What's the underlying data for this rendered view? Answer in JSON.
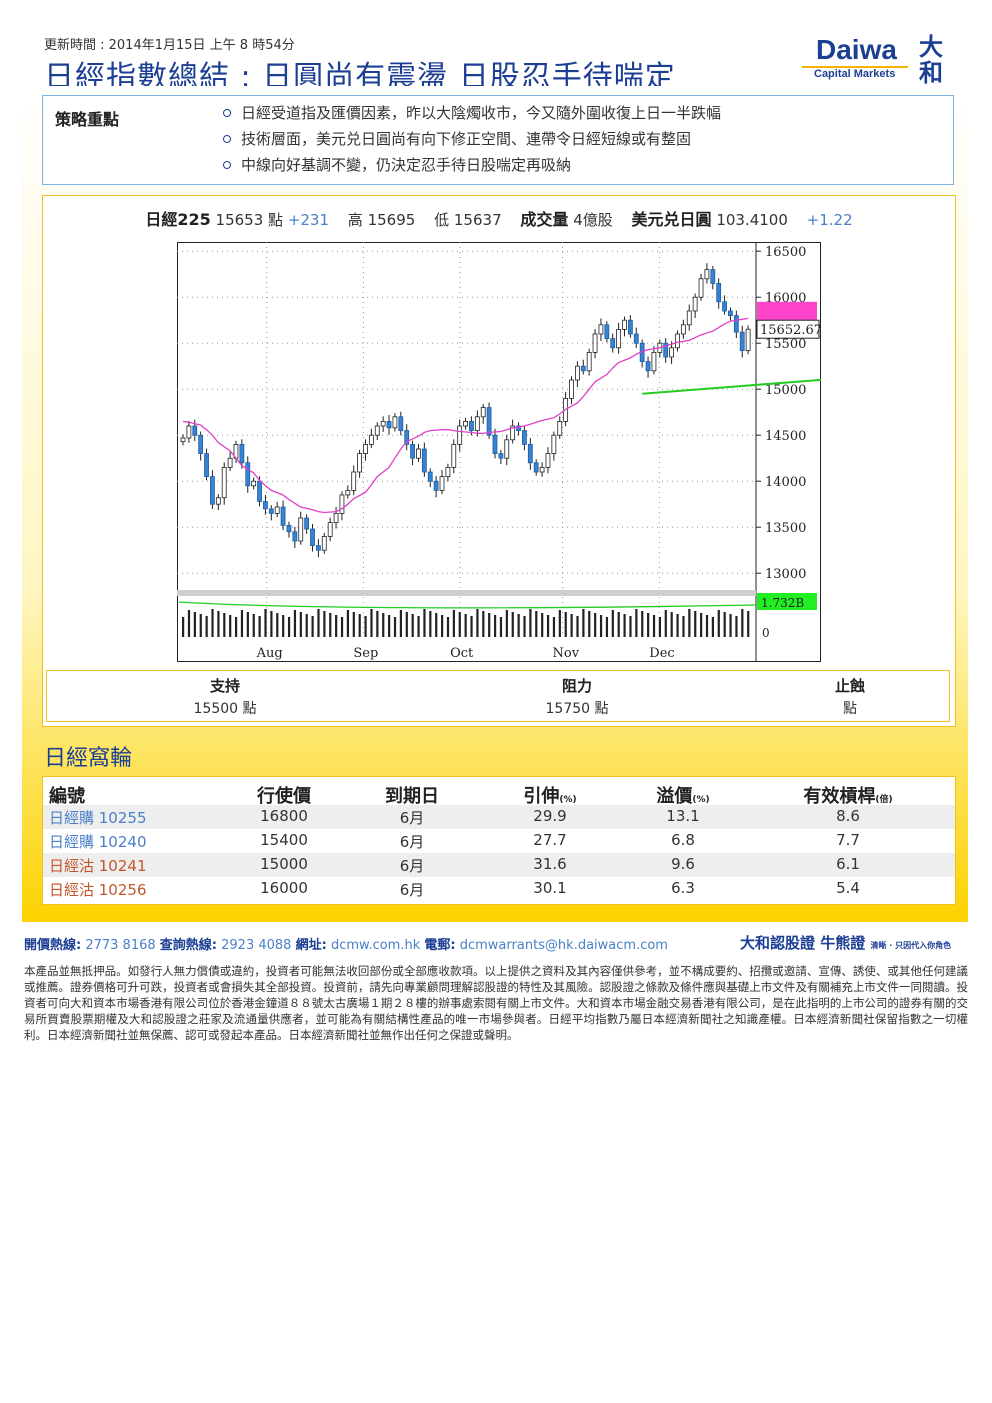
{
  "header": {
    "updated": "更新時間 : 2014年1月15日 上午 8 時54分",
    "title": "日經指數總結 : 日圓尚有震盪 日股忍手待喘定",
    "logo": {
      "brand": "Daiwa",
      "sub": "Capital Markets",
      "kanji_top": "大",
      "kanji_bottom": "和"
    }
  },
  "strategy": {
    "label": "策略重點",
    "points": [
      "日經受道指及匯價因素，昨以大陰燭收市，今又隨外圍收復上日一半跌幅",
      "技術層面，美元兑日圓尚有向下修正空間、連帶令日經短線或有整固",
      "中線向好基調不變，仍決定忍手待日股喘定再吸納"
    ]
  },
  "stats": {
    "index_label": "日經225",
    "index_value": "15653 點",
    "index_change": "+231",
    "high_label": "高",
    "high_value": "15695",
    "low_label": "低",
    "low_value": "15637",
    "volume_label": "成交量",
    "volume_value": "4億股",
    "fx_label": "美元兑日圓",
    "fx_value": "103.4100",
    "fx_change": "+1.22"
  },
  "chart_data": {
    "type": "candlestick",
    "x_ticks": [
      "Aug",
      "Sep",
      "Oct",
      "Nov",
      "Dec"
    ],
    "y_ticks": [
      16500,
      16000,
      15500,
      15000,
      14500,
      14000,
      13500,
      13000
    ],
    "ylim": [
      12850,
      16600
    ],
    "last_price_label": "15652.67",
    "volume_label": "1.732B",
    "volume_zero_label": "0",
    "closes": [
      14470,
      14600,
      14500,
      14300,
      14050,
      13750,
      13820,
      14150,
      14250,
      14400,
      14200,
      13950,
      14000,
      13780,
      13700,
      13650,
      13720,
      13520,
      13450,
      13350,
      13600,
      13480,
      13300,
      13250,
      13400,
      13550,
      13650,
      13850,
      13900,
      14100,
      14300,
      14400,
      14500,
      14600,
      14650,
      14580,
      14700,
      14550,
      14400,
      14250,
      14350,
      14100,
      14000,
      13900,
      14050,
      14150,
      14400,
      14600,
      14650,
      14550,
      14700,
      14800,
      14500,
      14300,
      14250,
      14450,
      14600,
      14550,
      14400,
      14200,
      14100,
      14150,
      14300,
      14500,
      14650,
      14900,
      15100,
      15250,
      15200,
      15400,
      15600,
      15700,
      15550,
      15450,
      15650,
      15750,
      15600,
      15500,
      15300,
      15200,
      15400,
      15500,
      15350,
      15450,
      15600,
      15700,
      15850,
      16000,
      16200,
      16300,
      16150,
      15950,
      15850,
      15800,
      15620,
      15420,
      15652
    ],
    "ma_closes": [
      14650,
      14640,
      14610,
      14560,
      14500,
      14420,
      14330,
      14250,
      14170,
      14090,
      14010,
      13950,
      13900,
      13850,
      13800,
      13760,
      13720,
      13690,
      13670,
      13660,
      13670,
      13700,
      13750,
      13810,
      13880,
      13960,
      14050,
      14150,
      14250,
      14350,
      14430,
      14490,
      14530,
      14550,
      14560,
      14560,
      14550,
      14540,
      14530,
      14520,
      14520,
      14530,
      14540,
      14560,
      14580,
      14600,
      14620,
      14640,
      14660,
      14690,
      14730,
      14780,
      14850,
      14920,
      15000,
      15080,
      15160,
      15230,
      15290,
      15340,
      15380,
      15410,
      15430,
      15450,
      15470,
      15490,
      15510,
      15530,
      15560,
      15590,
      15630,
      15670,
      15710,
      15740,
      15760,
      15770
    ],
    "support_line": [
      [
        78,
        14950
      ],
      [
        144,
        15280
      ]
    ],
    "resist_line": [
      [
        124,
        16450
      ],
      [
        146,
        15750
      ]
    ],
    "levels_header": [
      "支持",
      "阻力",
      "止蝕"
    ],
    "levels_values": [
      "15500 點",
      "15750 點",
      "點"
    ]
  },
  "warrants": {
    "title": "日經窩輪",
    "headers": [
      "編號",
      "行使價",
      "到期日",
      "引伸",
      "溢價",
      "有效槓桿"
    ],
    "header_units": [
      "",
      "",
      "",
      "(%)",
      "(%)",
      "(倍)"
    ],
    "rows": [
      [
        "日經購 10255",
        "16800",
        "6月",
        "29.9",
        "13.1",
        "8.6"
      ],
      [
        "日經購 10240",
        "15400",
        "6月",
        "27.7",
        "6.8",
        "7.7"
      ],
      [
        "日經沽 10241",
        "15000",
        "6月",
        "31.6",
        "9.6",
        "6.1"
      ],
      [
        "日經沽 10256",
        "16000",
        "6月",
        "30.1",
        "6.3",
        "5.4"
      ]
    ],
    "row_colors": [
      "#4a80c8",
      "#4a80c8",
      "#c0572a",
      "#c0572a"
    ]
  },
  "footer": {
    "hotline_label": "開價熱線:",
    "hotline": "2773 8168",
    "query_label": "查詢熱線:",
    "query": "2923 4088",
    "web_label": "網址:",
    "web": "dcmw.com.hk",
    "email_label": "電郵:",
    "email": "dcmwarrants@hk.daiwacm.com",
    "brand": "大和認股證 牛熊證",
    "brand_tag": "清晰 · 只因代入你角色",
    "disclaimer": "本產品並無抵押品。如發行人無力償債或違約，投資者可能無法收回部份或全部應收款項。以上提供之資料及其內容僅供參考，並不構成要約、招攬或邀請、宣傳、誘使、或其他任何建議或推薦。證券價格可升可跌，投資者或會損失其全部投資。投資前，請先向專業顧問理解認股證的特性及其風險。認股證之條款及條件應與基礎上市文件及有關補充上市文件一同閱讀。投資者可向大和資本市場香港有限公司位於香港金鐘道８８號太古廣場１期２８樓的辦事處索閱有關上市文件。大和資本市場金融交易香港有限公司，是在此指明的上市公司的證券有關的交易所買賣股票期權及大和認股證之莊家及流通量供應者，並可能為有關結構性產品的唯一市場參與者。日經平均指數乃屬日本經濟新聞社之知識產權。日本經濟新聞社保留指數之一切權利。日本經濟新聞社並無保薦、認可或發起本產品。日本經濟新聞社並無作出任何之保證或聲明。"
  }
}
